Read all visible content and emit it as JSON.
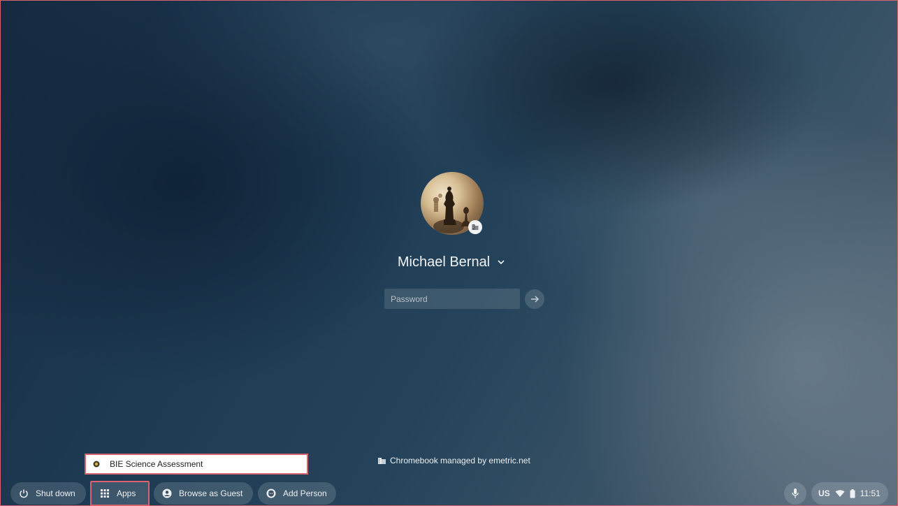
{
  "login": {
    "user_name": "Michael Bernal",
    "password_placeholder": "Password"
  },
  "managed_notice": "Chromebook managed by emetric.net",
  "apps_popup": {
    "items": [
      {
        "label": "BIE Science Assessment",
        "icon": "app-icon"
      }
    ]
  },
  "shelf": {
    "shutdown_label": "Shut down",
    "apps_label": "Apps",
    "guest_label": "Browse as Guest",
    "add_person_label": "Add Person"
  },
  "tray": {
    "keyboard_layout": "US",
    "time": "11:51"
  },
  "colors": {
    "highlight_border": "#d9636f",
    "text_light": "#eef1f3"
  }
}
